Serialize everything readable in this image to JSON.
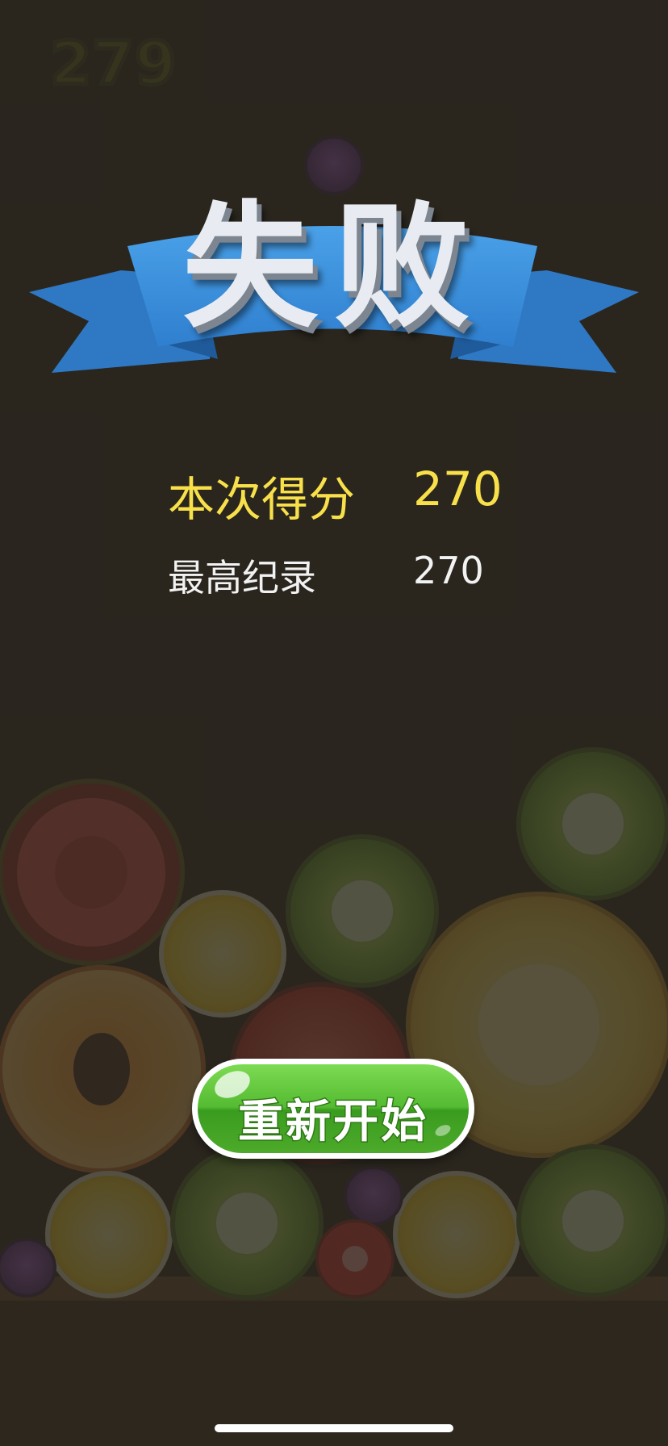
{
  "hud": {
    "score": "279"
  },
  "gameover": {
    "title": "失败",
    "current_label": "本次得分",
    "current_value": "270",
    "best_label": "最高纪录",
    "best_value": "270",
    "restart_label": "重新开始"
  },
  "fruits": [
    {
      "kind": "watermelon-slice"
    },
    {
      "kind": "kiwi"
    },
    {
      "kind": "tomato"
    },
    {
      "kind": "lemon"
    },
    {
      "kind": "kiwi"
    },
    {
      "kind": "melon"
    },
    {
      "kind": "peach"
    },
    {
      "kind": "tomato"
    },
    {
      "kind": "lemon"
    },
    {
      "kind": "kiwi"
    },
    {
      "kind": "lemon"
    },
    {
      "kind": "kiwi"
    },
    {
      "kind": "grape"
    },
    {
      "kind": "strawberry"
    },
    {
      "kind": "grape"
    },
    {
      "kind": "grape"
    }
  ],
  "colors": {
    "background": "#1b1813",
    "ribbon": "#3b8fd8",
    "current_score": "#f8e04a",
    "button_green": "#54bb32"
  }
}
